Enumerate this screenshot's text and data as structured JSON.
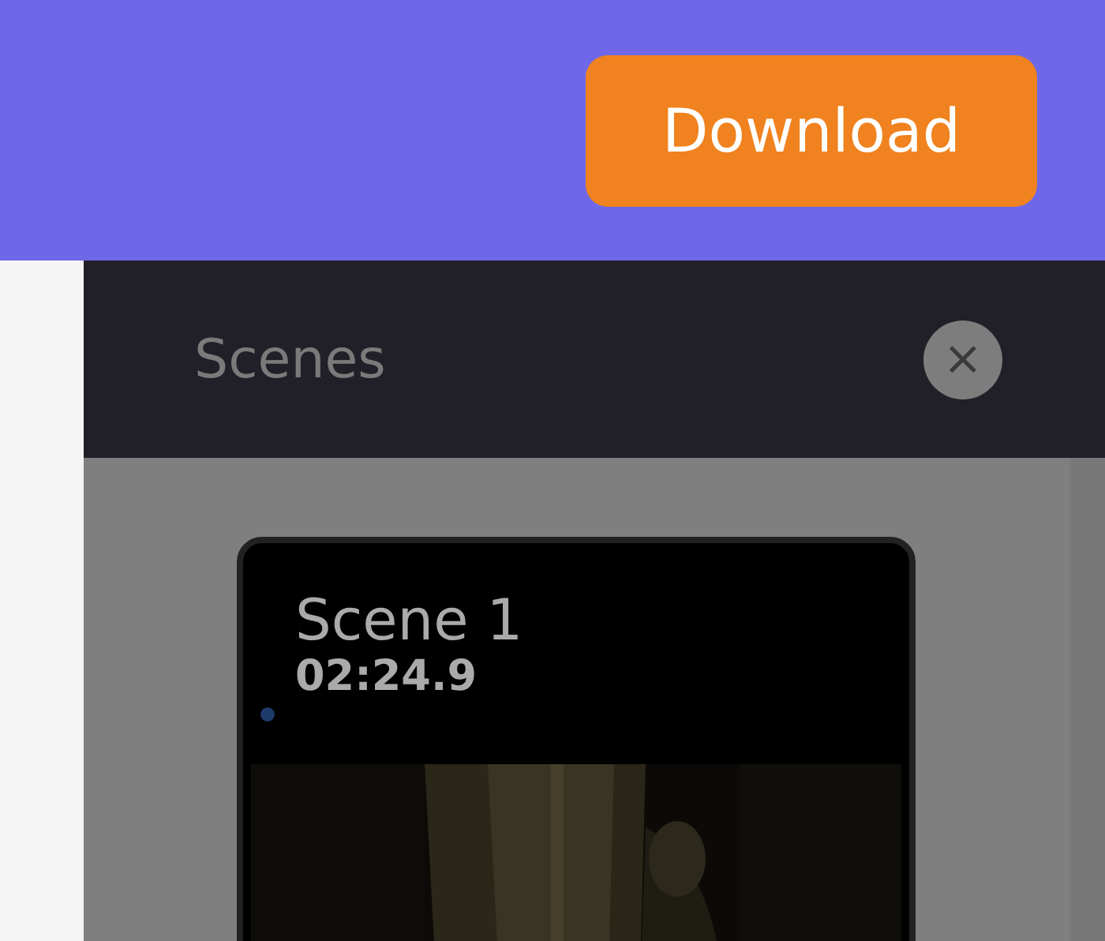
{
  "header": {
    "download_button": "Download"
  },
  "scenes_panel": {
    "title": "Scenes",
    "close_symbol": "×",
    "scenes": [
      {
        "title": "Scene 1",
        "time": "02:24.9"
      }
    ]
  }
}
